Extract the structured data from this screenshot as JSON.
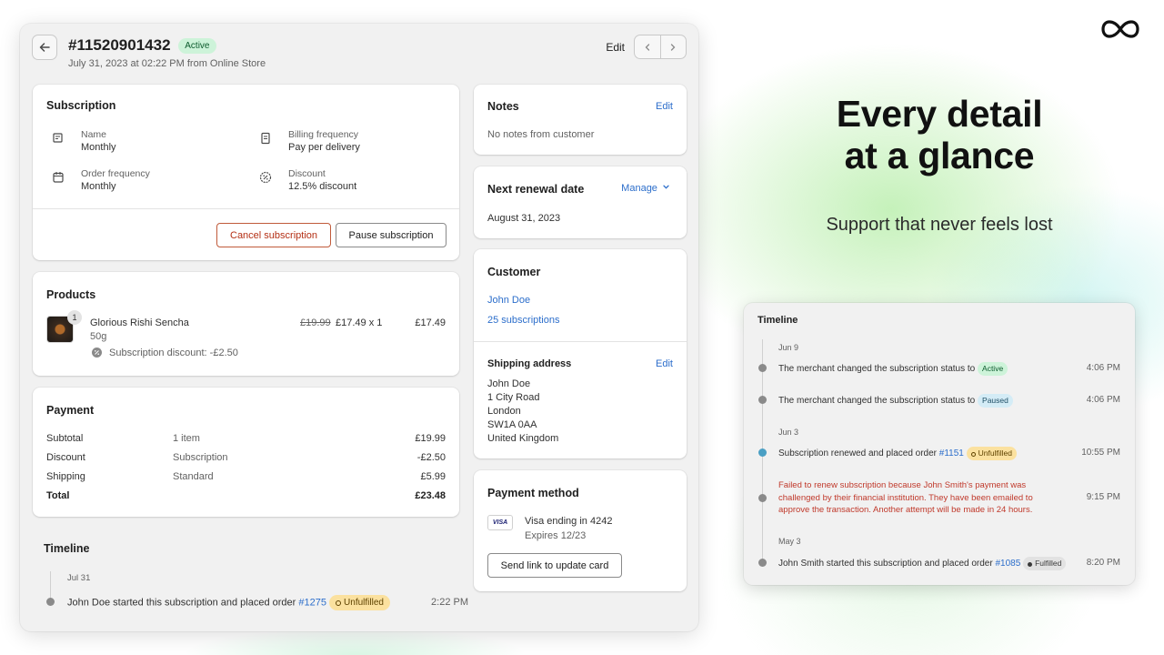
{
  "header": {
    "order_number": "#11520901432",
    "status": "Active",
    "subtitle": "July 31, 2023 at 02:22 PM from Online Store",
    "edit_label": "Edit"
  },
  "subscription": {
    "title": "Subscription",
    "name_label": "Name",
    "name_value": "Monthly",
    "billing_label": "Billing frequency",
    "billing_value": "Pay per delivery",
    "order_freq_label": "Order frequency",
    "order_freq_value": "Monthly",
    "discount_label": "Discount",
    "discount_value": "12.5% discount",
    "cancel_label": "Cancel subscription",
    "pause_label": "Pause subscription"
  },
  "products": {
    "title": "Products",
    "items": [
      {
        "quantity_badge": "1",
        "name": "Glorious Rishi Sencha",
        "variant": "50g",
        "original_price": "£19.99",
        "price_qty": "£17.49 x 1",
        "total": "£17.49",
        "discount_note": "Subscription discount: -£2.50"
      }
    ]
  },
  "payment": {
    "title": "Payment",
    "rows": [
      {
        "label": "Subtotal",
        "detail": "1 item",
        "amount": "£19.99"
      },
      {
        "label": "Discount",
        "detail": "Subscription",
        "amount": "-£2.50"
      },
      {
        "label": "Shipping",
        "detail": "Standard",
        "amount": "£5.99"
      }
    ],
    "total_label": "Total",
    "total_amount": "£23.48"
  },
  "timeline_main": {
    "title": "Timeline",
    "date": "Jul 31",
    "event_text": "John Doe started this subscription and placed order",
    "event_link": "#1275",
    "event_badge": "Unfulfilled",
    "event_time": "2:22 PM"
  },
  "notes": {
    "title": "Notes",
    "edit_label": "Edit",
    "text": "No notes from customer"
  },
  "renewal": {
    "title": "Next renewal date",
    "manage_label": "Manage",
    "date": "August 31, 2023"
  },
  "customer": {
    "title": "Customer",
    "name": "John Doe",
    "subscriptions": "25 subscriptions",
    "shipping_title": "Shipping address",
    "shipping_edit": "Edit",
    "address": [
      "John Doe",
      "1 City Road",
      "London",
      "SW1A 0AA",
      "United Kingdom"
    ]
  },
  "payment_method": {
    "title": "Payment method",
    "card_brand": "VISA",
    "card_text": "Visa ending in 4242",
    "expires": "Expires 12/23",
    "send_link_label": "Send link to update card"
  },
  "hero": {
    "title_line1": "Every detail",
    "title_line2": "at a glance",
    "subtitle": "Support that never feels lost"
  },
  "timeline_card": {
    "title": "Timeline",
    "groups": [
      {
        "date": "Jun 9"
      },
      {
        "date": "Jun 3"
      },
      {
        "date": "May 3"
      }
    ],
    "events": [
      {
        "text": "The merchant changed the subscription status to",
        "badge": "Active",
        "time": "4:06 PM"
      },
      {
        "text": "The merchant changed the subscription status to",
        "badge": "Paused",
        "time": "4:06 PM"
      },
      {
        "text": "Subscription renewed and placed order",
        "link": "#1151",
        "badge": "Unfulfilled",
        "time": "10:55 PM"
      },
      {
        "text_lines": [
          "Failed to renew subscription because John Smith's payment was",
          "challenged by their financial institution. They have been emailed to",
          "approve the transaction. Another attempt will be made in 24 hours."
        ],
        "time": "9:15 PM"
      },
      {
        "text": "John Smith started this subscription and placed order",
        "link": "#1085",
        "badge": "Fulfilled",
        "time": "8:20 PM"
      }
    ]
  },
  "colors": {
    "accent_link": "#2c6ecb",
    "danger": "#b42f14",
    "active_badge": "#cdf3d9",
    "unfulfilled_badge": "#fbe19f",
    "error_text": "#c0392b"
  }
}
